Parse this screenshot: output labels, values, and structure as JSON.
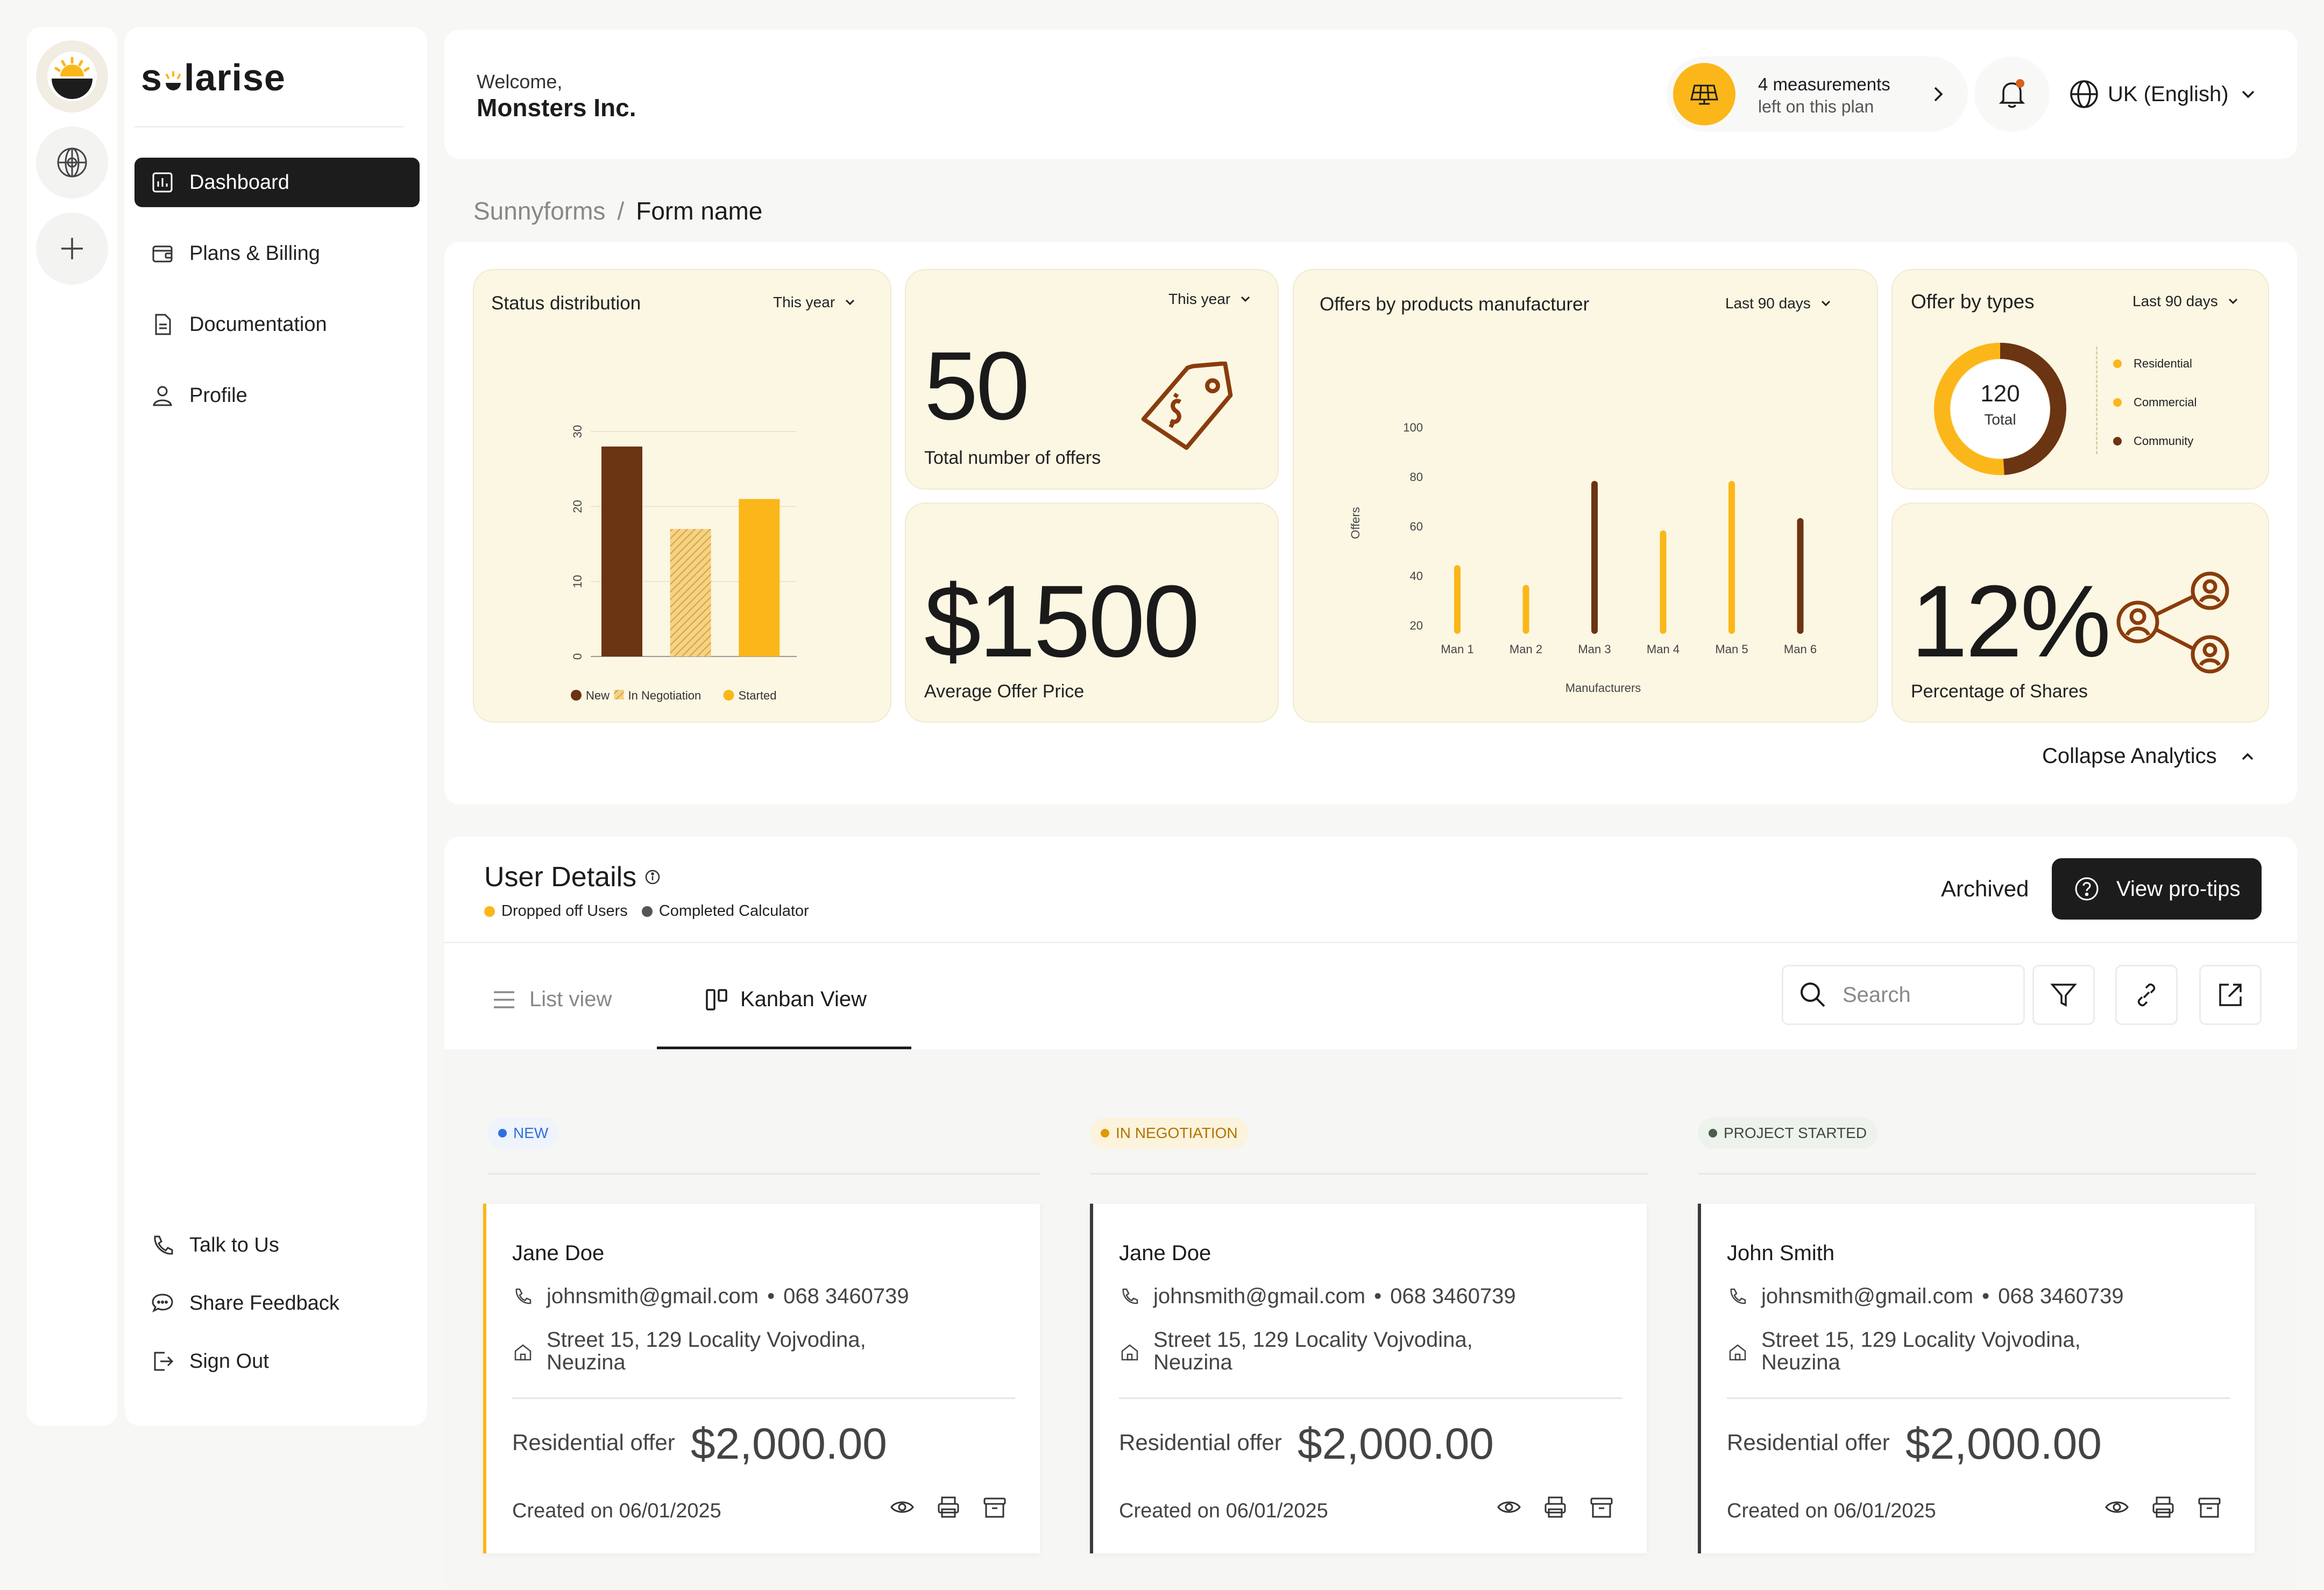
{
  "app": {
    "logo_text": "solarise"
  },
  "sidebar": {
    "items": [
      {
        "label": "Dashboard"
      },
      {
        "label": "Plans & Billing"
      },
      {
        "label": "Documentation"
      },
      {
        "label": "Profile"
      }
    ],
    "bottom": [
      {
        "label": "Talk to Us"
      },
      {
        "label": "Share Feedback"
      },
      {
        "label": "Sign Out"
      }
    ]
  },
  "header": {
    "welcome": "Welcome,",
    "company": "Monsters Inc.",
    "measurements_line1": "4 measurements",
    "measurements_line2": "left on this plan",
    "language": "UK (English)"
  },
  "breadcrumb": {
    "parent": "Sunnyforms",
    "separator": "/",
    "current": "Form name"
  },
  "analytics": {
    "collapse_label": "Collapse Analytics",
    "status_card": {
      "title": "Status distribution",
      "filter": "This year"
    },
    "offers_card": {
      "value": "50",
      "caption": "Total number of offers",
      "filter": "This year"
    },
    "price_card": {
      "value": "$1500",
      "caption": "Average Offer Price"
    },
    "manufacturer_card": {
      "title": "Offers by products manufacturer",
      "filter": "Last 90 days"
    },
    "types_card": {
      "title": "Offer by types",
      "filter": "Last 90 days",
      "total_value": "120",
      "total_label": "Total"
    },
    "shares_card": {
      "value": "12%",
      "caption": "Percentage of Shares"
    }
  },
  "chart_data": [
    {
      "type": "bar",
      "title": "Status distribution",
      "categories": [
        "New",
        "In Negotiation",
        "Started"
      ],
      "values": [
        28,
        17,
        21
      ],
      "ylim": [
        0,
        30
      ],
      "yticks": [
        "0",
        "10",
        "20",
        "30"
      ],
      "legend": [
        "New",
        "In Negotiation",
        "Started"
      ],
      "legend_position": "bottom",
      "colors": [
        "#6b3412",
        "#e9b64c",
        "#fbb719"
      ]
    },
    {
      "type": "bar",
      "title": "Offers by products manufacturer",
      "categories": [
        "Man 1",
        "Man 2",
        "Man 3",
        "Man 4",
        "Man 5",
        "Man 6"
      ],
      "values": [
        43,
        35,
        77,
        57,
        77,
        62
      ],
      "ylim": [
        20,
        100
      ],
      "yticks": [
        "20",
        "40",
        "60",
        "80",
        "100"
      ],
      "xlabel": "Manufacturers",
      "ylabel": "Offers",
      "colors": [
        "#fbb719",
        "#fbb719",
        "#6b3412",
        "#fbb719",
        "#fbb719",
        "#6b3412"
      ]
    },
    {
      "type": "pie",
      "title": "Offer by types",
      "categories": [
        "Residential",
        "Commercial",
        "Community"
      ],
      "values": [
        48,
        3,
        49
      ],
      "legend_position": "right",
      "colors": [
        "#fbb719",
        "#fbb719",
        "#6b3412"
      ]
    }
  ],
  "users": {
    "title": "User Details",
    "legend": [
      {
        "label": "Dropped off Users",
        "color": "#fbb719"
      },
      {
        "label": "Completed Calculator",
        "color": "#555555"
      }
    ],
    "archived_label": "Archived",
    "protips_label": "View pro-tips",
    "tabs": [
      {
        "label": "List view"
      },
      {
        "label": "Kanban View"
      }
    ],
    "search_placeholder": "Search",
    "columns": [
      {
        "status": "NEW",
        "status_color": "#2f6fe0",
        "badge_bg": "#eef3fc",
        "card": {
          "name": "Jane Doe",
          "email": "johnsmith@gmail.com",
          "phone": "068 3460739",
          "address1": "Street 15, 129 Locality Vojvodina,",
          "address2": "Neuzina",
          "offer_label": "Residential offer",
          "price": "$2,000.00",
          "created": "Created on 06/01/2025"
        }
      },
      {
        "status": "IN NEGOTIATION",
        "status_color": "#e09a00",
        "badge_bg": "#fcf3dd",
        "card": {
          "name": "Jane Doe",
          "email": "johnsmith@gmail.com",
          "phone": "068 3460739",
          "address1": "Street 15, 129 Locality Vojvodina,",
          "address2": "Neuzina",
          "offer_label": "Residential offer",
          "price": "$2,000.00",
          "created": "Created on 06/01/2025"
        }
      },
      {
        "status": "PROJECT STARTED",
        "status_color": "#4b5e4b",
        "badge_bg": "#eef2ec",
        "card": {
          "name": "John Smith",
          "email": "johnsmith@gmail.com",
          "phone": "068 3460739",
          "address1": "Street 15, 129 Locality Vojvodina,",
          "address2": "Neuzina",
          "offer_label": "Residential offer",
          "price": "$2,000.00",
          "created": "Created on 06/01/2025"
        }
      }
    ],
    "bullet": "•"
  },
  "colors": {
    "accent": "#fbb719",
    "brown": "#6b3412",
    "card_bg": "#fcf7e3",
    "dark": "#1c1c1c"
  }
}
